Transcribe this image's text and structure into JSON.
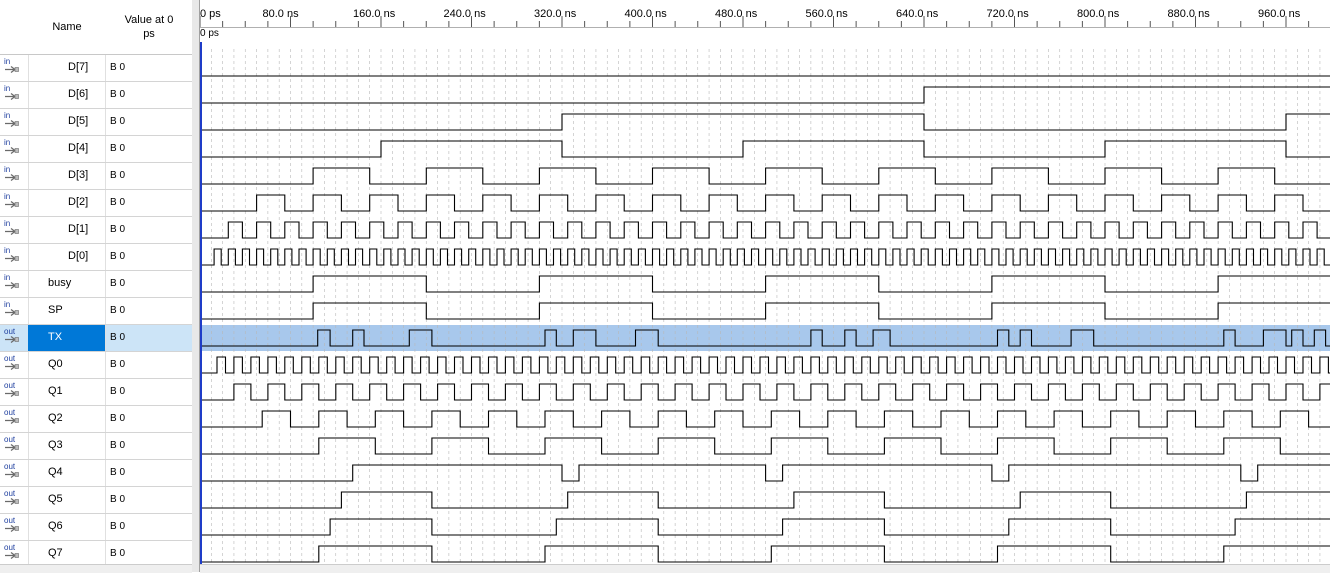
{
  "header": {
    "name_label": "Name",
    "value_label": "Value at 0 ps"
  },
  "ruler": {
    "cursor_label": "0 ps",
    "ticks": [
      "0 ps",
      "80.0 ns",
      "160.0 ns",
      "240.0 ns",
      "320.0 ns",
      "400.0 ns",
      "480.0 ns",
      "560.0 ns",
      "640.0 ns",
      "720.0 ns",
      "800.0 ns",
      "880.0 ns",
      "960.0 ns"
    ]
  },
  "signals": [
    {
      "dir": "in",
      "name": "D[7]",
      "value": "B 0",
      "selected": false,
      "wave": []
    },
    {
      "dir": "in",
      "name": "D[6]",
      "value": "B 0",
      "selected": false,
      "wave": [
        [
          640,
          1000
        ]
      ]
    },
    {
      "dir": "in",
      "name": "D[5]",
      "value": "B 0",
      "selected": false,
      "wave": [
        [
          320,
          640
        ],
        [
          960,
          1000
        ]
      ]
    },
    {
      "dir": "in",
      "name": "D[4]",
      "value": "B 0",
      "selected": false,
      "wave": [
        [
          160,
          320
        ],
        [
          480,
          640
        ],
        [
          800,
          960
        ]
      ]
    },
    {
      "dir": "in",
      "name": "D[3]",
      "value": "B 0",
      "selected": false,
      "wave": "period80"
    },
    {
      "dir": "in",
      "name": "D[2]",
      "value": "B 0",
      "selected": false,
      "wave": "period40"
    },
    {
      "dir": "in",
      "name": "D[1]",
      "value": "B 0",
      "selected": false,
      "wave": "period20"
    },
    {
      "dir": "in",
      "name": "D[0]",
      "value": "B 0",
      "selected": false,
      "wave": "period10"
    },
    {
      "dir": "in",
      "name": "busy",
      "value": "B 0",
      "selected": false,
      "wave": [
        [
          100,
          200
        ],
        [
          300,
          400
        ],
        [
          500,
          600
        ],
        [
          700,
          800
        ],
        [
          900,
          1000
        ]
      ]
    },
    {
      "dir": "in",
      "name": "SP",
      "value": "B 0",
      "selected": false,
      "wave": [
        [
          100,
          200
        ],
        [
          300,
          400
        ],
        [
          500,
          600
        ],
        [
          700,
          800
        ],
        [
          900,
          1000
        ]
      ]
    },
    {
      "dir": "out",
      "name": "TX",
      "value": "B 0",
      "selected": true,
      "wave": [
        [
          104,
          115
        ],
        [
          135,
          145
        ],
        [
          185,
          205
        ],
        [
          305,
          315
        ],
        [
          330,
          350
        ],
        [
          385,
          405
        ],
        [
          540,
          550
        ],
        [
          570,
          580
        ],
        [
          595,
          610
        ],
        [
          705,
          715
        ],
        [
          725,
          735
        ],
        [
          770,
          790
        ],
        [
          905,
          915
        ],
        [
          940,
          960
        ],
        [
          965,
          975
        ],
        [
          985,
          995
        ]
      ]
    },
    {
      "dir": "out",
      "name": "Q0",
      "value": "B 0",
      "selected": false,
      "wave": "period10b"
    },
    {
      "dir": "out",
      "name": "Q1",
      "value": "B 0",
      "selected": false,
      "wave": "period20b"
    },
    {
      "dir": "out",
      "name": "Q2",
      "value": "B 0",
      "selected": false,
      "wave": "period40b"
    },
    {
      "dir": "out",
      "name": "Q3",
      "value": "B 0",
      "selected": false,
      "wave": "period80b"
    },
    {
      "dir": "out",
      "name": "Q4",
      "value": "B 0",
      "selected": false,
      "wave": [
        [
          135,
          320
        ],
        [
          335,
          500
        ],
        [
          515,
          700
        ],
        [
          715,
          920
        ],
        [
          935,
          1000
        ]
      ]
    },
    {
      "dir": "out",
      "name": "Q5",
      "value": "B 0",
      "selected": false,
      "wave": [
        [
          125,
          205
        ],
        [
          325,
          405
        ],
        [
          525,
          605
        ],
        [
          725,
          805
        ],
        [
          925,
          1000
        ]
      ]
    },
    {
      "dir": "out",
      "name": "Q6",
      "value": "B 0",
      "selected": false,
      "wave": [
        [
          115,
          205
        ],
        [
          315,
          405
        ],
        [
          515,
          605
        ],
        [
          715,
          805
        ],
        [
          915,
          1000
        ]
      ]
    },
    {
      "dir": "out",
      "name": "Q7",
      "value": "B 0",
      "selected": false,
      "wave": [
        [
          105,
          205
        ],
        [
          305,
          405
        ],
        [
          505,
          605
        ],
        [
          705,
          805
        ],
        [
          905,
          1000
        ]
      ]
    }
  ],
  "colors": {
    "selected_row": "#cce4f7",
    "selected_name": "#0078d7",
    "grid": "#b8b8b8",
    "wave": "#000000",
    "cursor": "#1e3cc8",
    "tx_fill": "#a8c8ec"
  }
}
